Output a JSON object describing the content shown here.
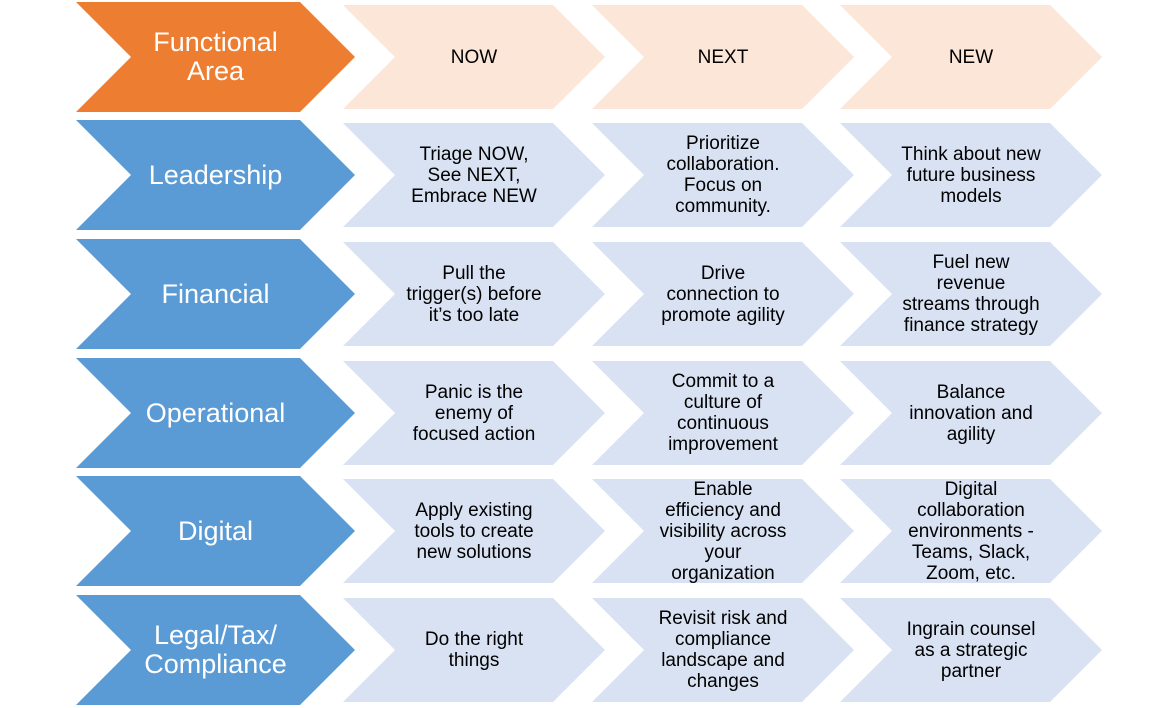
{
  "colors": {
    "header_area": "#ED7D31",
    "header_cell": "#FBE6D8",
    "row_area": "#5B9BD5",
    "row_cell": "#D9E2F2"
  },
  "header": {
    "area_label": "Functional\nArea",
    "columns": [
      "NOW",
      "NEXT",
      "NEW"
    ]
  },
  "rows": [
    {
      "area": "Leadership",
      "cells": [
        "Triage NOW,\nSee NEXT,\nEmbrace NEW",
        "Prioritize\ncollaboration.\nFocus on\ncommunity.",
        "Think about new\nfuture business\nmodels"
      ]
    },
    {
      "area": "Financial",
      "cells": [
        "Pull the\ntrigger(s) before\nit’s too late",
        "Drive\nconnection to\npromote agility",
        "Fuel new\nrevenue\nstreams through\nfinance strategy"
      ]
    },
    {
      "area": "Operational",
      "cells": [
        "Panic is the\nenemy of\nfocused action",
        "Commit to a\nculture of\ncontinuous\nimprovement",
        "Balance\ninnovation and\nagility"
      ]
    },
    {
      "area": "Digital",
      "cells": [
        "Apply existing\ntools to create\nnew solutions",
        "Enable\nefficiency and\nvisibility across\nyour\norganization",
        "Digital\ncollaboration\nenvironments -\nTeams, Slack,\nZoom, etc."
      ]
    },
    {
      "area": "Legal/Tax/\nCompliance",
      "cells": [
        "Do the right\nthings",
        "Revisit risk and\ncompliance\nlandscape and\nchanges",
        "Ingrain counsel\nas a strategic\npartner"
      ]
    }
  ]
}
